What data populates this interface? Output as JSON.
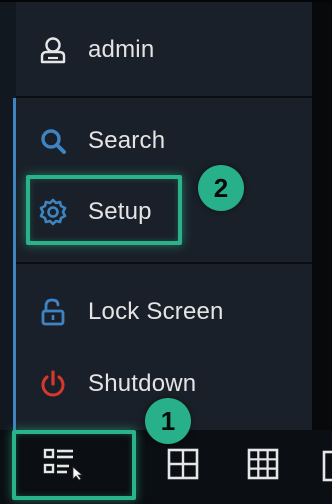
{
  "menu": {
    "user_label": "admin",
    "search_label": "Search",
    "setup_label": "Setup",
    "lock_label": "Lock Screen",
    "shutdown_label": "Shutdown"
  },
  "annotations": {
    "step1": "1",
    "step2": "2"
  },
  "icons": {
    "user": "user-icon",
    "search": "search-icon",
    "setup": "gear-icon",
    "lock": "lock-icon",
    "shutdown": "power-icon",
    "start_menu": "menu-list-icon",
    "layout_4": "grid-2x2-icon",
    "layout_9": "grid-3x3-icon"
  },
  "colors": {
    "accent_green": "#2ab38a",
    "search_blue": "#3f84c2",
    "shutdown_red": "#d8372c",
    "menu_bg": "#1a2029"
  }
}
